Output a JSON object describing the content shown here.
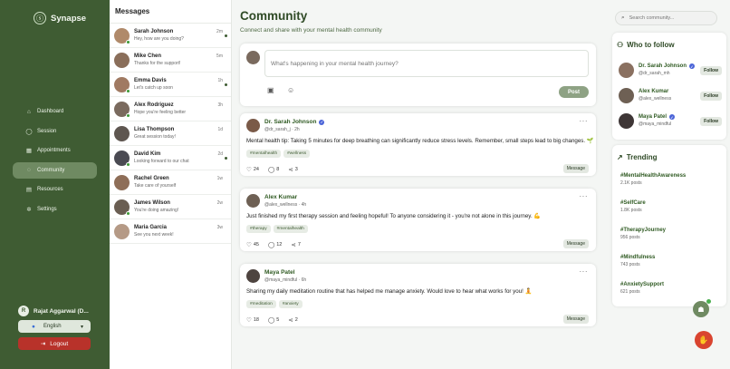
{
  "brand": {
    "name": "Synapse",
    "logo_icon": "brain-icon"
  },
  "nav": [
    {
      "label": "Dashboard",
      "icon": "home-icon",
      "glyph": "⌂",
      "active": false
    },
    {
      "label": "Session",
      "icon": "user-icon",
      "glyph": "◯",
      "active": false
    },
    {
      "label": "Appointments",
      "icon": "calendar-icon",
      "glyph": "▦",
      "active": false
    },
    {
      "label": "Community",
      "icon": "chat-icon",
      "glyph": "◌",
      "active": true
    },
    {
      "label": "Resources",
      "icon": "book-icon",
      "glyph": "▤",
      "active": false
    },
    {
      "label": "Settings",
      "icon": "gear-icon",
      "glyph": "✲",
      "active": false
    }
  ],
  "user": {
    "initial": "R",
    "name": "Rajat Aggarwal (D..."
  },
  "language": {
    "selected": "English"
  },
  "logout": {
    "label": "Logout"
  },
  "messages": {
    "title": "Messages",
    "items": [
      {
        "name": "Sarah Johnson",
        "preview": "Hey, how are you doing?",
        "time": "2m",
        "online": true,
        "unread": true,
        "color": "#b08a6a"
      },
      {
        "name": "Mike Chen",
        "preview": "Thanks for the support!",
        "time": "5m",
        "online": false,
        "unread": false,
        "color": "#8a6e5a"
      },
      {
        "name": "Emma Davis",
        "preview": "Let's catch up soon",
        "time": "1h",
        "online": true,
        "unread": true,
        "color": "#a07a62"
      },
      {
        "name": "Alex Rodriguez",
        "preview": "Hope you're feeling better",
        "time": "3h",
        "online": true,
        "unread": false,
        "color": "#7a6a5e"
      },
      {
        "name": "Lisa Thompson",
        "preview": "Great session today!",
        "time": "1d",
        "online": false,
        "unread": false,
        "color": "#5e5650"
      },
      {
        "name": "David Kim",
        "preview": "Looking forward to our chat",
        "time": "2d",
        "online": true,
        "unread": true,
        "color": "#4a4a52"
      },
      {
        "name": "Rachel Green",
        "preview": "Take care of yourself",
        "time": "1w",
        "online": false,
        "unread": false,
        "color": "#8e6e58"
      },
      {
        "name": "James Wilson",
        "preview": "You're doing amazing!",
        "time": "2w",
        "online": true,
        "unread": false,
        "color": "#6a5e52"
      },
      {
        "name": "Maria Garcia",
        "preview": "See you next week!",
        "time": "3w",
        "online": false,
        "unread": false,
        "color": "#b59a86"
      }
    ]
  },
  "community": {
    "title": "Community",
    "subtitle": "Connect and share with your mental health community",
    "composer": {
      "placeholder": "What's happening in your mental health journey?",
      "post_label": "Post"
    },
    "posts": [
      {
        "author": "Dr. Sarah Johnson",
        "verified": true,
        "meta": "@dr_sarah_j · 2h",
        "text": "Mental health tip: Taking 5 minutes for deep breathing can significantly reduce stress levels. Remember, small steps lead to big changes. 🌱",
        "tags": [
          "#mentalhealth",
          "#wellness"
        ],
        "likes": "24",
        "comments": "8",
        "shares": "3",
        "message_label": "Message",
        "color": "#7a5a48"
      },
      {
        "author": "Alex Kumar",
        "verified": false,
        "meta": "@alex_wellness · 4h",
        "text": "Just finished my first therapy session and feeling hopeful! To anyone considering it - you're not alone in this journey. 💪",
        "tags": [
          "#therapy",
          "#mentalhealth"
        ],
        "likes": "45",
        "comments": "12",
        "shares": "7",
        "message_label": "Message",
        "color": "#6e6054"
      },
      {
        "author": "Maya Patel",
        "verified": false,
        "meta": "@maya_mindful · 6h",
        "text": "Sharing my daily meditation routine that has helped me manage anxiety. Would love to hear what works for you! 🧘",
        "tags": [
          "#meditation",
          "#anxiety"
        ],
        "likes": "18",
        "comments": "5",
        "shares": "2",
        "message_label": "Message",
        "color": "#4e4440"
      }
    ]
  },
  "search": {
    "placeholder": "Search community..."
  },
  "who_to_follow": {
    "title": "Who to follow",
    "items": [
      {
        "name": "Dr. Sarah Johnson",
        "verified": true,
        "handle": "@dr_sarah_mh",
        "follow_label": "Follow",
        "color": "#8a7060"
      },
      {
        "name": "Alex Kumar",
        "verified": false,
        "handle": "@alex_wellness",
        "follow_label": "Follow",
        "color": "#6e6054"
      },
      {
        "name": "Maya Patel",
        "verified": true,
        "handle": "@maya_mindful",
        "follow_label": "Follow",
        "color": "#3e3636"
      }
    ]
  },
  "trending": {
    "title": "Trending",
    "items": [
      {
        "tag": "#MentalHealthAwareness",
        "count": "2.1K posts"
      },
      {
        "tag": "#SelfCare",
        "count": "1.8K posts"
      },
      {
        "tag": "#TherapyJourney",
        "count": "956 posts"
      },
      {
        "tag": "#Mindfulness",
        "count": "743 posts"
      },
      {
        "tag": "#AnxietySupport",
        "count": "621 posts"
      }
    ]
  },
  "colors": {
    "sidebar": "#3f5c33",
    "accent": "#2f5a22",
    "logout": "#b8322a",
    "verified": "#4b64d8"
  }
}
